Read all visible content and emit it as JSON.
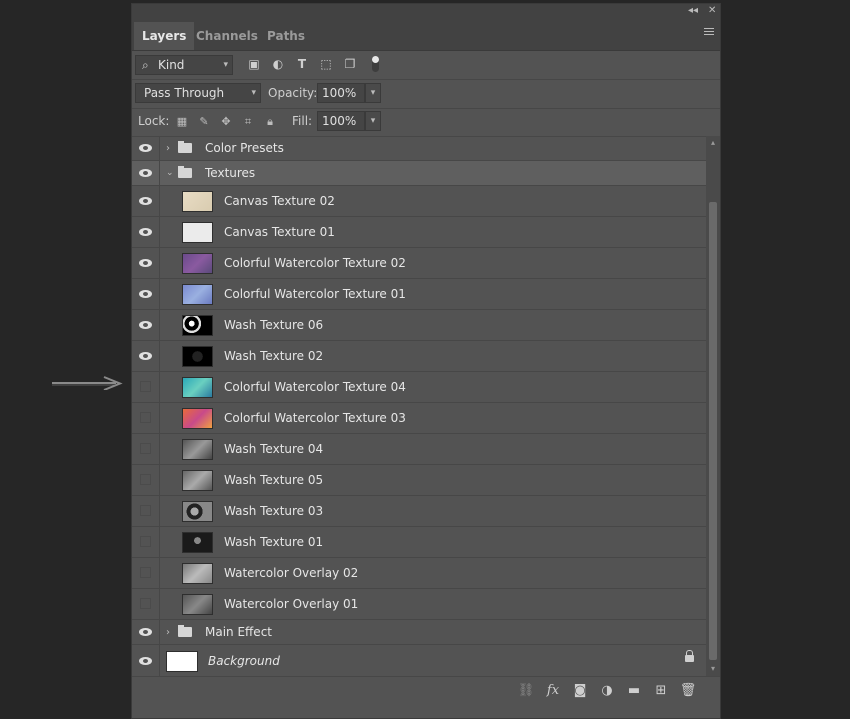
{
  "tabs": [
    "Layers",
    "Channels",
    "Paths"
  ],
  "filter": {
    "label": "Kind"
  },
  "blend": {
    "mode": "Pass Through",
    "opacity_label": "Opacity:",
    "opacity": "100%"
  },
  "lock": {
    "label": "Lock:",
    "fill_label": "Fill:",
    "fill": "100%"
  },
  "groups": {
    "color_presets": "Color Presets",
    "textures": "Textures",
    "main_effect": "Main Effect"
  },
  "layers": [
    {
      "name": "Canvas Texture 02",
      "visible": true
    },
    {
      "name": "Canvas Texture 01",
      "visible": true
    },
    {
      "name": "Colorful Watercolor Texture 02",
      "visible": true
    },
    {
      "name": "Colorful Watercolor Texture 01",
      "visible": true
    },
    {
      "name": "Wash Texture 06",
      "visible": true
    },
    {
      "name": "Wash Texture 02",
      "visible": true
    },
    {
      "name": "Colorful Watercolor Texture 04",
      "visible": false
    },
    {
      "name": "Colorful Watercolor Texture 03",
      "visible": false
    },
    {
      "name": "Wash Texture 04",
      "visible": false
    },
    {
      "name": "Wash Texture 05",
      "visible": false
    },
    {
      "name": "Wash Texture 03",
      "visible": false
    },
    {
      "name": "Wash Texture 01",
      "visible": false
    },
    {
      "name": "Watercolor Overlay 02",
      "visible": false
    },
    {
      "name": "Watercolor Overlay 01",
      "visible": false
    }
  ],
  "background": {
    "name": "Background"
  },
  "colors": {
    "panel": "#535353",
    "selected_group": "#5f5f5f"
  }
}
